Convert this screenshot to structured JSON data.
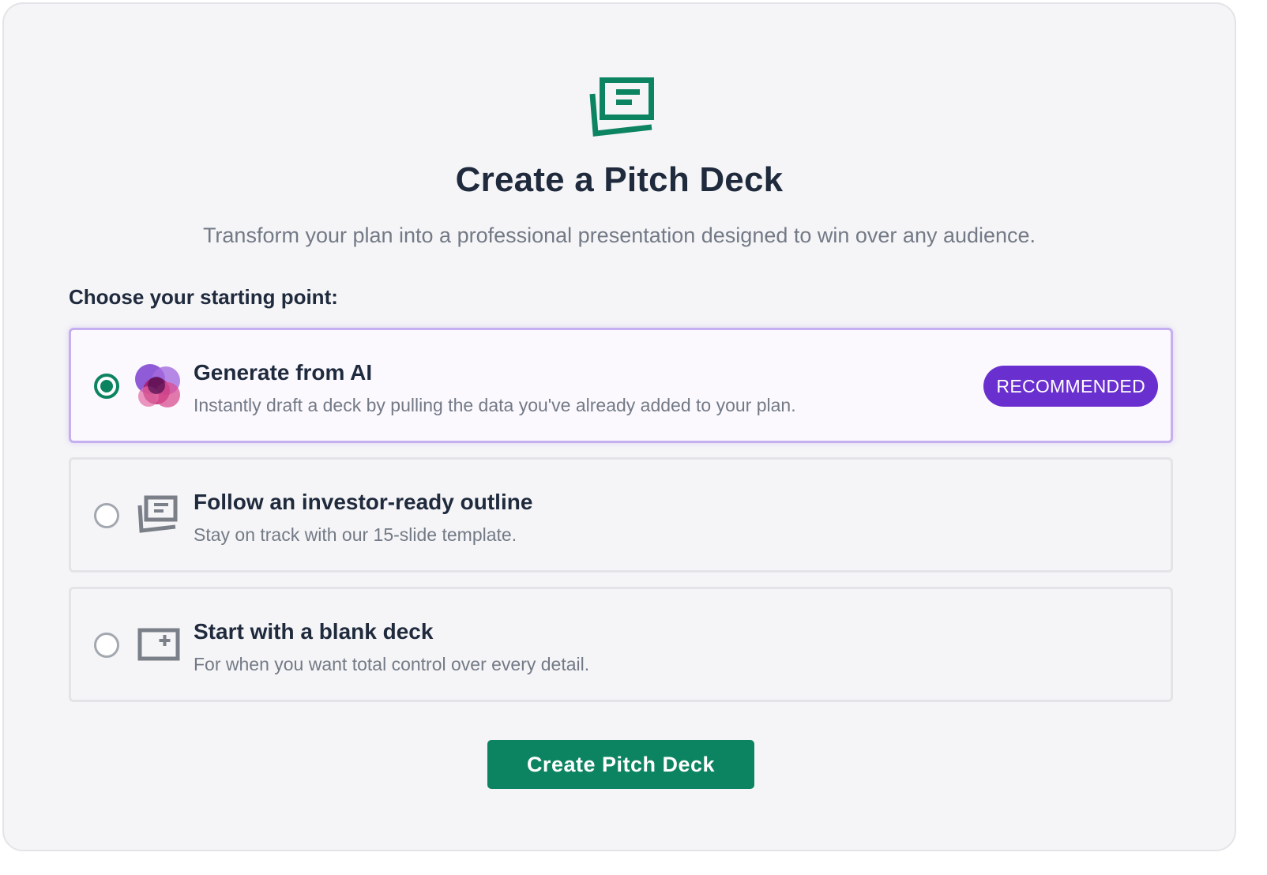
{
  "header": {
    "icon": "pitch-deck-icon",
    "title": "Create a Pitch Deck",
    "subtitle": "Transform your plan into a professional presentation designed to win over any audience."
  },
  "choose_label": "Choose your starting point:",
  "options": [
    {
      "title": "Generate from AI",
      "description": "Instantly draft a deck by pulling the data you've already added to your plan.",
      "icon": "ai-blob-icon",
      "badge": "RECOMMENDED",
      "selected": true
    },
    {
      "title": "Follow an investor-ready outline",
      "description": "Stay on track with our 15-slide template.",
      "icon": "outline-slides-icon",
      "selected": false
    },
    {
      "title": "Start with a blank deck",
      "description": "For when you want total control over every detail.",
      "icon": "blank-slide-plus-icon",
      "selected": false
    }
  ],
  "cta_label": "Create Pitch Deck",
  "colors": {
    "primary_green": "#0d8461",
    "badge_purple": "#6a2fcf",
    "selected_border": "#c5aff0",
    "title_text": "#1f2a3d",
    "muted_text": "#737a86"
  }
}
